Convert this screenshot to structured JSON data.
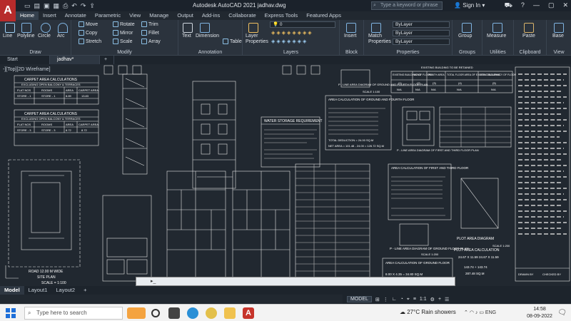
{
  "app": {
    "title": "Autodesk AutoCAD 2021  jadhav.dwg",
    "logo_letter": "A",
    "search_placeholder": "Type a keyword or phrase",
    "sign_in": "Sign In"
  },
  "ribbon_tabs": [
    "Home",
    "Insert",
    "Annotate",
    "Parametric",
    "View",
    "Manage",
    "Output",
    "Add-ins",
    "Collaborate",
    "Express Tools",
    "Featured Apps"
  ],
  "active_tab": "Home",
  "panels": {
    "draw": {
      "label": "Draw",
      "tools": [
        "Line",
        "Polyline",
        "Circle",
        "Arc"
      ]
    },
    "modify": {
      "label": "Modify",
      "tools": [
        "Move",
        "Rotate",
        "Trim",
        "Copy",
        "Mirror",
        "Fillet",
        "Stretch",
        "Scale",
        "Array"
      ]
    },
    "annotation": {
      "label": "Annotation",
      "tools": [
        "Text",
        "Dimension",
        "Table"
      ]
    },
    "layers": {
      "label": "Layers",
      "tool": "Layer Properties",
      "layer_value": "0"
    },
    "block": {
      "label": "Block",
      "tool": "Insert"
    },
    "properties": {
      "label": "Properties",
      "tool": "Match Properties",
      "bylayer1": "ByLayer",
      "bylayer2": "ByLayer",
      "bylayer3": "ByLayer"
    },
    "groups": {
      "label": "Groups",
      "tool": "Group"
    },
    "utilities": {
      "label": "Utilities",
      "tool": "Measure"
    },
    "clipboard": {
      "label": "Clipboard",
      "tool": "Paste"
    },
    "view": {
      "label": "View",
      "tool": "Base"
    }
  },
  "doc_tabs": [
    "Start",
    "jadhav*"
  ],
  "viewport_label": "-][Top][2D Wireframe]",
  "drawing_text": {
    "carpet1_title": "CARPET AREA CALCULATIONS",
    "carpet1_sub": "EXCLUDING OPEN BALCONY & TERRACES",
    "carpet_cols": [
      "FLAT NOS",
      "ROOMS",
      "AREA",
      "CARPET AREA"
    ],
    "carpet1_row": [
      "STORE - 1",
      "STORE - 1",
      "8.89",
      "13.83"
    ],
    "carpet2_title": "CARPET AREA CALCULATIONS",
    "carpet2_sub": "EXCLUDING OPEN BALCONY & TERRACES",
    "carpet2_row": [
      "STORE - 3",
      "STORE - 3",
      "8.72",
      "8.72"
    ],
    "water_title": "WATER STORAGE REQUIREMENT",
    "area_calc1": "AREA CALCULATION OF GROUND AND FOURTH FLOOR",
    "area_calc2": "AREA CALCULATION OF FIRST AND THIRD FLOOR",
    "pline1": "P - LINE AREA DIAGRAM OF GROUND AND FOURTH FLOOR PLAN",
    "pline2": "P - LINE AREA DIAGRAM OF FIRST AND THIRD FLOOR PLAN",
    "pline3": "P - LINE AREA DIAGRAM OF GROUND FLOOR PLAN",
    "scale_1_100": "SCALE 1:100",
    "scale_1_200": "SCALE 1:200",
    "existing_title": "EXISTING BUILDING TO BE RETAINED",
    "existing_cols": [
      "EXISTING BUILDING NO",
      "NO OF FLOORS",
      "PLINTH AREA",
      "TOTAL FLOOR AREA OF EXISTING BUILDING",
      "USE / OCCUPANCY OF FLOOR"
    ],
    "existing_row1": [
      "(1)",
      "(2)",
      "(3)",
      "(4)",
      "(5)"
    ],
    "existing_row2": [
      "N/A",
      "N/A",
      "N/A",
      "N/A",
      "N/A"
    ],
    "plot_diagram": "PLOT AREA DIAGRAM",
    "plot_calc": "PLOT AREA CALCULATION",
    "plot_dims": "24.67 X 11.59     24.67 X 11.59",
    "plot_vals": "143.74 + 143.74",
    "plot_total": "287.48  SQ.M",
    "area_ground": "AREA CALCULATION OF GROUND FLOOR",
    "area_ground_val": "8.00 X 4.35 = 34.80 SQ.M",
    "road": "ROAD 12.00 M WIDE",
    "site_plan": "SITE PLAN",
    "site_scale": "SCALE = 1:100",
    "drawn_by": "DRAWN BY",
    "checked_by": "CHECKED BY",
    "total_deduction": "TOTAL DEDUCTION =  24.00 SQ.M",
    "net_area": "NET AREA = 101.48 - 24.00 = 126.72 SQ.M"
  },
  "layout_tabs": [
    "Model",
    "Layout1",
    "Layout2"
  ],
  "status": {
    "model": "MODEL",
    "scale": "1:1"
  },
  "taskbar": {
    "search": "Type here to search",
    "weather": "27°C  Rain showers",
    "lang": "ENG",
    "time": "14:58",
    "date": "08-09-2022"
  }
}
